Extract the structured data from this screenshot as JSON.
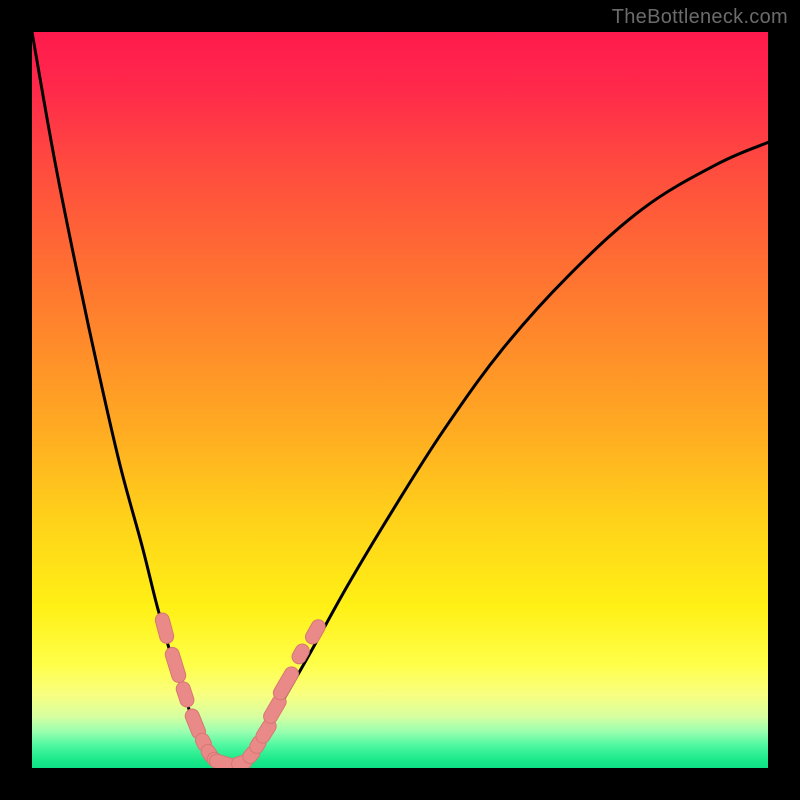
{
  "watermark": "TheBottleneck.com",
  "colors": {
    "frame": "#000000",
    "curve_stroke": "#000000",
    "marker_fill": "#e98a88",
    "marker_stroke": "#d87674",
    "watermark_text": "#6b6b6b"
  },
  "chart_data": {
    "type": "line",
    "title": "",
    "xlabel": "",
    "ylabel": "",
    "xlim": [
      0,
      100
    ],
    "ylim": [
      0,
      100
    ],
    "background_gradient": {
      "direction": "top_to_bottom",
      "stops": [
        {
          "pos": 0.0,
          "hex": "#ff1a4d",
          "meaning": "high"
        },
        {
          "pos": 0.5,
          "hex": "#ff9a25",
          "meaning": "mid"
        },
        {
          "pos": 0.82,
          "hex": "#ffff2a",
          "meaning": "low"
        },
        {
          "pos": 1.0,
          "hex": "#18e889",
          "meaning": "ideal"
        }
      ]
    },
    "series": [
      {
        "name": "left_branch",
        "x": [
          0,
          3,
          6,
          9,
          12,
          15,
          17,
          19,
          21,
          22,
          23,
          24,
          25
        ],
        "y": [
          100,
          83,
          68,
          54,
          41,
          30,
          22,
          15,
          9,
          6,
          4,
          2,
          1
        ]
      },
      {
        "name": "valley_floor",
        "x": [
          25,
          26,
          27,
          28,
          29
        ],
        "y": [
          1,
          0.5,
          0.4,
          0.5,
          1
        ]
      },
      {
        "name": "right_branch",
        "x": [
          29,
          31,
          34,
          38,
          43,
          49,
          56,
          64,
          73,
          83,
          93,
          100
        ],
        "y": [
          1,
          4,
          9,
          16,
          25,
          35,
          46,
          57,
          67,
          76,
          82,
          85
        ]
      }
    ],
    "markers": {
      "name": "highlighted_points",
      "shape": "rounded",
      "points": [
        {
          "x": 18.0,
          "y": 19.0,
          "len": 3.0
        },
        {
          "x": 19.5,
          "y": 14.0,
          "len": 3.5
        },
        {
          "x": 20.8,
          "y": 10.0,
          "len": 2.5
        },
        {
          "x": 22.2,
          "y": 6.0,
          "len": 3.0
        },
        {
          "x": 23.3,
          "y": 3.5,
          "len": 1.8
        },
        {
          "x": 24.1,
          "y": 2.0,
          "len": 1.8
        },
        {
          "x": 25.0,
          "y": 1.0,
          "len": 1.8
        },
        {
          "x": 26.5,
          "y": 0.5,
          "len": 3.5
        },
        {
          "x": 28.5,
          "y": 0.7,
          "len": 2.0
        },
        {
          "x": 29.8,
          "y": 1.8,
          "len": 1.8
        },
        {
          "x": 30.7,
          "y": 3.2,
          "len": 1.8
        },
        {
          "x": 31.8,
          "y": 5.0,
          "len": 2.5
        },
        {
          "x": 33.0,
          "y": 8.0,
          "len": 3.0
        },
        {
          "x": 34.5,
          "y": 11.5,
          "len": 3.5
        },
        {
          "x": 36.5,
          "y": 15.5,
          "len": 2.0
        },
        {
          "x": 38.5,
          "y": 18.5,
          "len": 2.5
        }
      ]
    }
  }
}
